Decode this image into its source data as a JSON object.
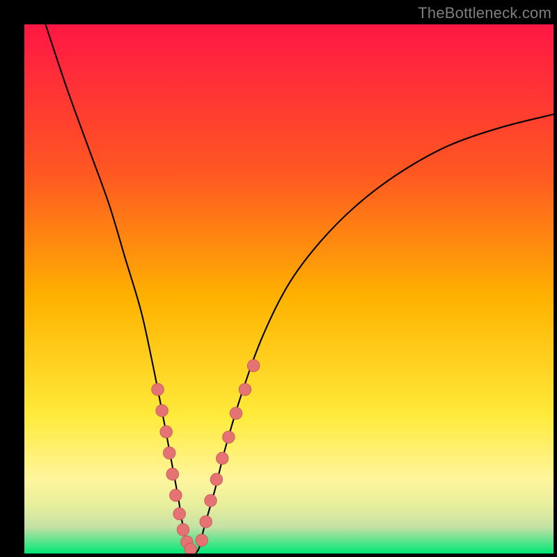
{
  "watermark": {
    "text": "TheBottleneck.com"
  },
  "colors": {
    "black": "#000000",
    "curve": "#000000",
    "dot_fill": "#e57373",
    "dot_stroke": "#c85a5a",
    "grad_top": "#ff1744",
    "grad_mid1": "#ff5722",
    "grad_mid2": "#ffb300",
    "grad_mid3": "#ffeb3b",
    "grad_band1": "#fff59d",
    "grad_band2": "#e6ee9c",
    "grad_band3": "#c5e1a5",
    "grad_bottom": "#00e676"
  },
  "chart_data": {
    "type": "line",
    "title": "",
    "xlabel": "",
    "ylabel": "",
    "xlim": [
      0,
      100
    ],
    "ylim": [
      0,
      100
    ],
    "grid": false,
    "legend": false,
    "series": [
      {
        "name": "bottleneck-curve",
        "x": [
          4,
          8,
          12,
          16,
          19,
          22,
          24,
          26,
          27.5,
          29,
          30,
          31,
          32,
          33,
          34,
          36,
          38,
          41,
          45,
          50,
          56,
          63,
          71,
          80,
          90,
          100
        ],
        "y": [
          100,
          88,
          77,
          66,
          56,
          46,
          37,
          27,
          19,
          11,
          5,
          1,
          0,
          1,
          5,
          12,
          20,
          30,
          41,
          51,
          59,
          66,
          72,
          77,
          80.5,
          83
        ]
      }
    ],
    "dots_left": {
      "name": "markers-left-branch",
      "x": [
        25.2,
        26.0,
        26.8,
        27.4,
        28.0,
        28.6,
        29.3,
        30.0,
        30.7,
        31.4
      ],
      "y": [
        31,
        27,
        23,
        19,
        15,
        11,
        7.5,
        4.5,
        2.2,
        0.8
      ]
    },
    "dots_right": {
      "name": "markers-right-branch",
      "x": [
        33.5,
        34.3,
        35.2,
        36.3,
        37.4,
        38.6,
        40.0,
        41.7,
        43.3
      ],
      "y": [
        2.5,
        6.0,
        10.0,
        14.0,
        18.0,
        22.0,
        26.5,
        31.0,
        35.5
      ]
    },
    "gradient_stops": [
      {
        "offset": 0,
        "key": "grad_top"
      },
      {
        "offset": 28,
        "key": "grad_mid1"
      },
      {
        "offset": 52,
        "key": "grad_mid2"
      },
      {
        "offset": 74,
        "key": "grad_mid3"
      },
      {
        "offset": 86,
        "key": "grad_band1"
      },
      {
        "offset": 91,
        "key": "grad_band2"
      },
      {
        "offset": 95,
        "key": "grad_band3"
      },
      {
        "offset": 100,
        "key": "grad_bottom"
      }
    ]
  }
}
